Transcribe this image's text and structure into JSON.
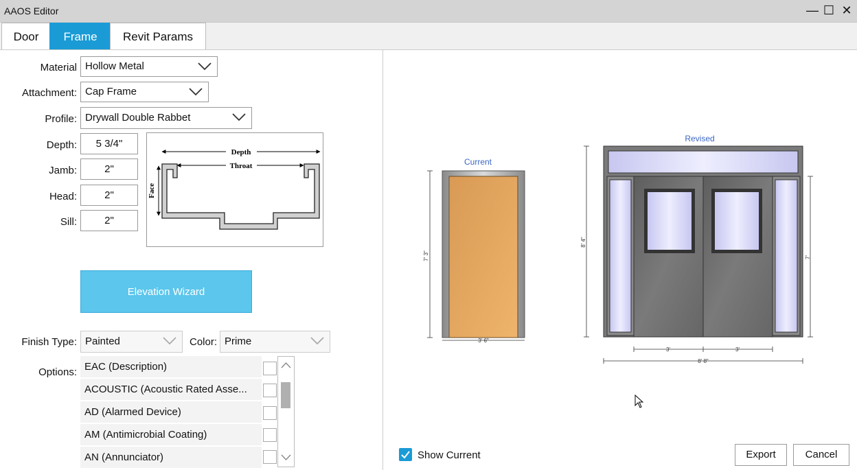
{
  "window": {
    "title": "AAOS Editor",
    "minimize": "—",
    "maximize": "☐",
    "close": "✕"
  },
  "tabs": [
    {
      "label": "Door"
    },
    {
      "label": "Frame"
    },
    {
      "label": "Revit Params"
    }
  ],
  "frame": {
    "material": {
      "label": "Material",
      "value": "Hollow Metal"
    },
    "attachment": {
      "label": "Attachment:",
      "value": "Cap Frame"
    },
    "profile": {
      "label": "Profile:",
      "value": "Drywall Double Rabbet"
    },
    "depth": {
      "label": "Depth:",
      "value": "5 3/4\""
    },
    "jamb": {
      "label": "Jamb:",
      "value": "2\""
    },
    "head": {
      "label": "Head:",
      "value": "2\""
    },
    "sill": {
      "label": "Sill:",
      "value": "2\""
    },
    "diagram": {
      "depth": "Depth",
      "throat": "Throat",
      "face": "Face"
    },
    "wizard_label": "Elevation Wizard",
    "finish_type": {
      "label": "Finish Type:",
      "value": "Painted"
    },
    "color": {
      "label": "Color:",
      "value": "Prime"
    },
    "options": {
      "label": "Options:",
      "items": [
        {
          "label": "EAC (Description)",
          "checked": false
        },
        {
          "label": "ACOUSTIC (Acoustic Rated Asse...",
          "checked": false
        },
        {
          "label": "AD (Alarmed Device)",
          "checked": false
        },
        {
          "label": "AM (Antimicrobial Coating)",
          "checked": false
        },
        {
          "label": "AN (Annunciator)",
          "checked": false
        }
      ]
    }
  },
  "preview": {
    "current": {
      "caption": "Current",
      "width": "3' 6\"",
      "height": "7' 3\""
    },
    "revised": {
      "caption": "Revised",
      "leaf_left": "3'",
      "leaf_right": "3'",
      "overall_width": "8' 8\"",
      "overall_height": "8' 4\"",
      "door_height": "7'"
    },
    "show_current": {
      "label": "Show Current",
      "checked": true
    }
  },
  "actions": {
    "export": "Export",
    "cancel": "Cancel"
  },
  "colors": {
    "accent": "#1a9bd6",
    "wizard": "#5cc6ec",
    "wood": "#e2a55b",
    "glass": "#dcdcfa",
    "door_gray": "#6e6e6e"
  }
}
